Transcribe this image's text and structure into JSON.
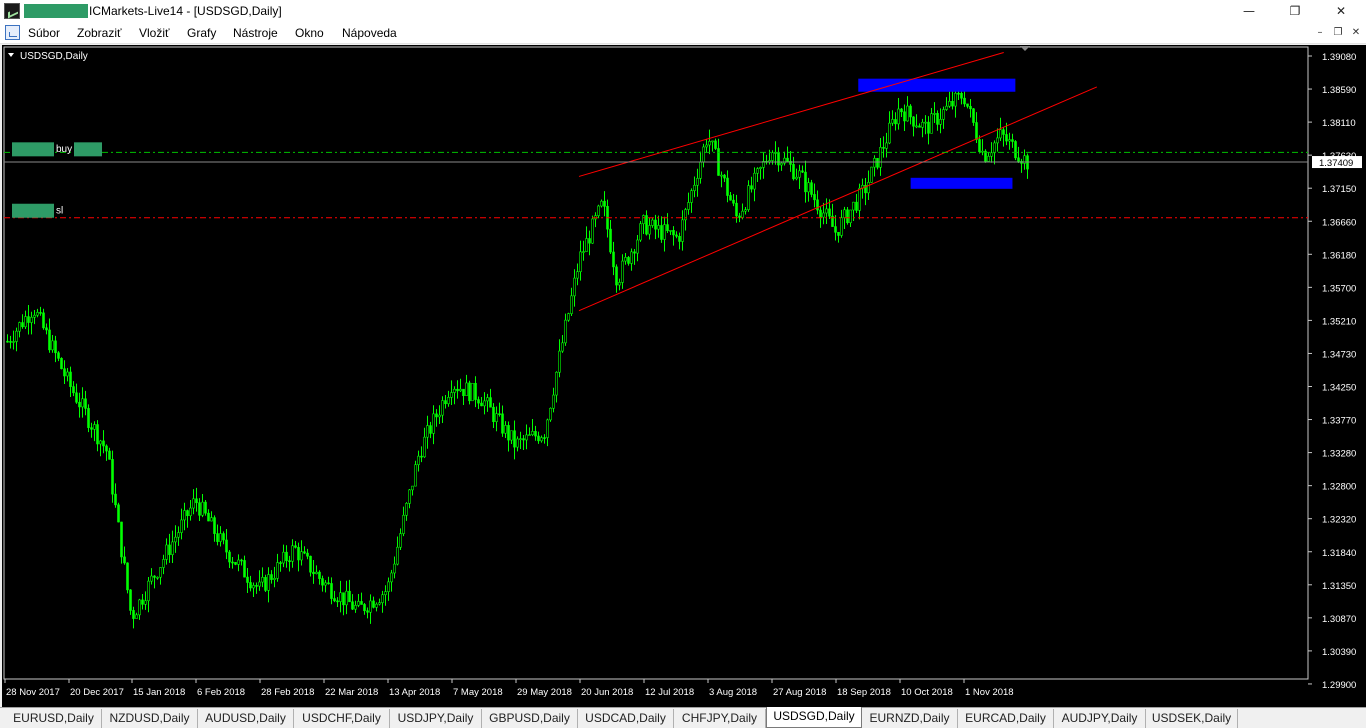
{
  "window": {
    "title": "ICMarkets-Live14 - [USDSGD,Daily]",
    "minimize_glyph": "—",
    "maximize_glyph": "❐",
    "close_glyph": "✕"
  },
  "menu": {
    "items": [
      "Súbor",
      "Zobraziť",
      "Vložiť",
      "Grafy",
      "Nástroje",
      "Okno",
      "Nápoveda"
    ],
    "mdi_minimize": "–",
    "mdi_restore": "❐",
    "mdi_close": "✕"
  },
  "chart": {
    "symbol_label": "USDSGD,Daily",
    "background": "#000000",
    "candle_color": "#00ff00",
    "price_scale": [
      "1.39080",
      "1.38590",
      "1.38110",
      "1.37630",
      "1.37150",
      "1.36660",
      "1.36180",
      "1.35700",
      "1.35210",
      "1.34730",
      "1.34250",
      "1.33770",
      "1.33280",
      "1.32800",
      "1.32320",
      "1.31840",
      "1.31350",
      "1.30870",
      "1.30390",
      "1.29900"
    ],
    "current_price": "1.37409",
    "date_labels": [
      "28 Nov 2017",
      "20 Dec 2017",
      "15 Jan 2018",
      "6 Feb 2018",
      "28 Feb 2018",
      "22 Mar 2018",
      "13 Apr 2018",
      "7 May 2018",
      "29 May 2018",
      "20 Jun 2018",
      "12 Jul 2018",
      "3 Aug 2018",
      "27 Aug 2018",
      "18 Sep 2018",
      "10 Oct 2018",
      "1 Nov 2018"
    ],
    "buy_line": {
      "label": "buy",
      "price": 1.3755,
      "color": "#00c000"
    },
    "sl_line": {
      "label": "sl",
      "price": 1.366,
      "color": "#ff0000"
    },
    "trend_color": "#ff0000",
    "zone_color": "#0000ff",
    "series_path": [
      [
        "28 Nov 2017",
        1.3475
      ],
      [
        "2017-12-08",
        1.353
      ],
      [
        "20 Dec 2017",
        1.342
      ],
      [
        "2018-01-05",
        1.332
      ],
      [
        "15 Jan 2018",
        1.308
      ],
      [
        "2018-01-24",
        1.315
      ],
      [
        "6 Feb 2018",
        1.325
      ],
      [
        "2018-02-16",
        1.318
      ],
      [
        "28 Feb 2018",
        1.312
      ],
      [
        "2018-03-12",
        1.318
      ],
      [
        "22 Mar 2018",
        1.313
      ],
      [
        "2018-04-03",
        1.309
      ],
      [
        "13 Apr 2018",
        1.312
      ],
      [
        "2018-04-25",
        1.332
      ],
      [
        "7 May 2018",
        1.342
      ],
      [
        "2018-05-17",
        1.34
      ],
      [
        "29 May 2018",
        1.333
      ],
      [
        "2018-06-08",
        1.335
      ],
      [
        "20 Jun 2018",
        1.36
      ],
      [
        "2018-06-28",
        1.368
      ],
      [
        "2018-07-03",
        1.357
      ],
      [
        "12 Jul 2018",
        1.365
      ],
      [
        "2018-07-24",
        1.363
      ],
      [
        "3 Aug 2018",
        1.378
      ],
      [
        "2018-08-14",
        1.366
      ],
      [
        "27 Aug 2018",
        1.376
      ],
      [
        "2018-09-06",
        1.372
      ],
      [
        "18 Sep 2018",
        1.364
      ],
      [
        "2018-09-28",
        1.37
      ],
      [
        "10 Oct 2018",
        1.382
      ],
      [
        "2018-10-19",
        1.379
      ],
      [
        "1 Nov 2018",
        1.384
      ],
      [
        "2018-11-08",
        1.375
      ],
      [
        "2018-11-14",
        1.378
      ],
      [
        "2018-11-23",
        1.3741
      ]
    ],
    "channel_upper": [
      [
        "20 Jun 2018",
        1.372
      ],
      [
        "2018-11-15",
        1.39
      ]
    ],
    "channel_lower": [
      [
        "20 Jun 2018",
        1.3525
      ],
      [
        "2018-12-17",
        1.385
      ]
    ],
    "resistance_zone": {
      "from": "2018-09-26",
      "to": "2018-11-19",
      "top": 1.3862,
      "bottom": 1.3843
    },
    "support_zone": {
      "from": "2018-10-14",
      "to": "2018-11-18",
      "top": 1.3718,
      "bottom": 1.3702
    }
  },
  "tabs": [
    "EURUSD,Daily",
    "NZDUSD,Daily",
    "AUDUSD,Daily",
    "USDCHF,Daily",
    "USDJPY,Daily",
    "GBPUSD,Daily",
    "USDCAD,Daily",
    "CHFJPY,Daily",
    "USDSGD,Daily",
    "EURNZD,Daily",
    "EURCAD,Daily",
    "AUDJPY,Daily",
    "USDSEK,Daily"
  ],
  "active_tab": "USDSGD,Daily"
}
